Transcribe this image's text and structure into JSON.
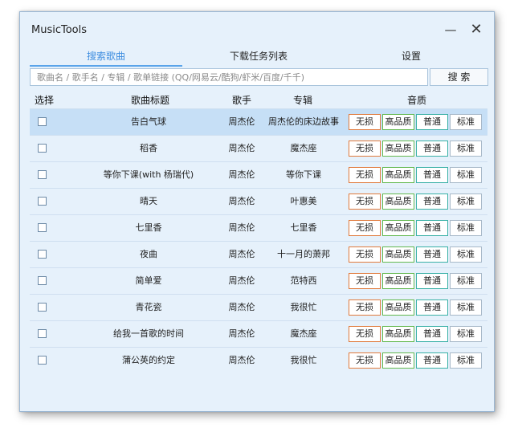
{
  "window": {
    "title": "MusicTools",
    "min_glyph": "—",
    "close_glyph": "✕"
  },
  "tabs": [
    {
      "label": "搜索歌曲",
      "active": true
    },
    {
      "label": "下载任务列表",
      "active": false
    },
    {
      "label": "设置",
      "active": false
    }
  ],
  "search": {
    "placeholder": "歌曲名 / 歌手名 / 专辑 / 歌单链接 (QQ/网易云/酷狗/虾米/百度/千千)",
    "value": "",
    "button_label": "搜 索"
  },
  "columns": {
    "select": "选择",
    "title": "歌曲标题",
    "artist": "歌手",
    "album": "专辑",
    "quality": "音质"
  },
  "quality_labels": {
    "lossless": "无损",
    "hq": "高品质",
    "normal": "普通",
    "std": "标准"
  },
  "rows": [
    {
      "title": "告白气球",
      "artist": "周杰伦",
      "album": "周杰伦的床边故事",
      "checked": false,
      "selected": true
    },
    {
      "title": "稻香",
      "artist": "周杰伦",
      "album": "魔杰座",
      "checked": false,
      "selected": false
    },
    {
      "title": "等你下课(with 杨瑞代)",
      "artist": "周杰伦",
      "album": "等你下课",
      "checked": false,
      "selected": false
    },
    {
      "title": "晴天",
      "artist": "周杰伦",
      "album": "叶惠美",
      "checked": false,
      "selected": false
    },
    {
      "title": "七里香",
      "artist": "周杰伦",
      "album": "七里香",
      "checked": false,
      "selected": false
    },
    {
      "title": "夜曲",
      "artist": "周杰伦",
      "album": "十一月的萧邦",
      "checked": false,
      "selected": false
    },
    {
      "title": "简单爱",
      "artist": "周杰伦",
      "album": "范特西",
      "checked": false,
      "selected": false
    },
    {
      "title": "青花瓷",
      "artist": "周杰伦",
      "album": "我很忙",
      "checked": false,
      "selected": false
    },
    {
      "title": "给我一首歌的时间",
      "artist": "周杰伦",
      "album": "魔杰座",
      "checked": false,
      "selected": false
    },
    {
      "title": "蒲公英的约定",
      "artist": "周杰伦",
      "album": "我很忙",
      "checked": false,
      "selected": false
    }
  ],
  "colors": {
    "window_bg": "#e6f1fb",
    "selected_row": "#c6dff6",
    "active_tab": "#3e8ee0",
    "lossless_border": "#e07a3c",
    "hq_border": "#62b84e",
    "normal_border": "#38b0a6",
    "std_border": "#a7b8c8"
  }
}
